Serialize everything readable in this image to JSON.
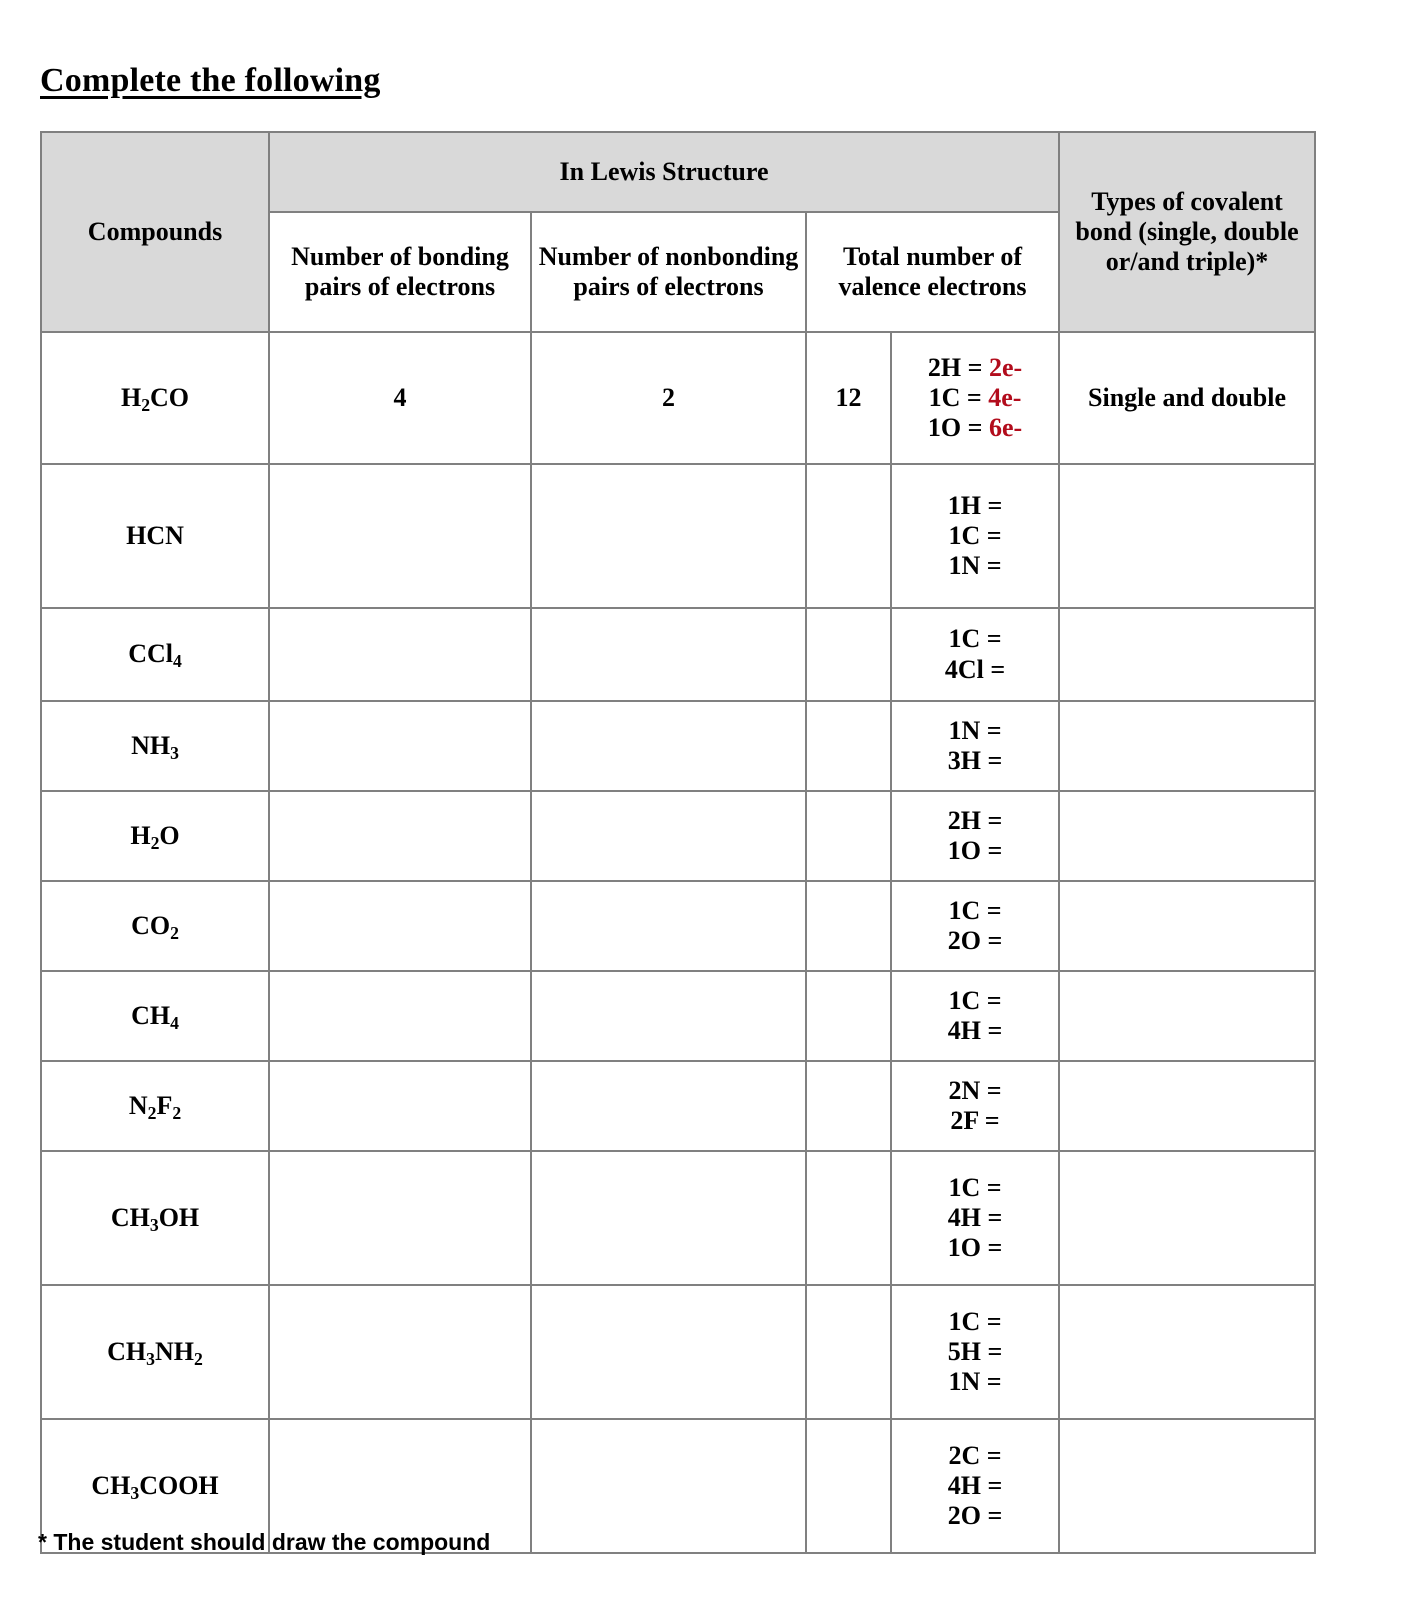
{
  "document": {
    "title": "Complete the following",
    "footnote": "* The student should draw the compound"
  },
  "colors": {
    "answer_red": "#b20c1c",
    "header_gray": "#d9d9d9",
    "border_gray": "#808080"
  },
  "table": {
    "headers": {
      "compounds": "Compounds",
      "lewis_group": "In Lewis Structure",
      "bonding_pairs": "Number of bonding pairs of electrons",
      "nonbonding_pairs": "Number of nonbonding pairs of electrons",
      "total_valence": "Total number of valence electrons",
      "bond_types": "Types of covalent bond (single, double or/and triple)*"
    },
    "rows": [
      {
        "compound": "H",
        "compound_sub1": "2",
        "compound_rest": "CO",
        "bonding_pairs": "4",
        "nonbonding_pairs": "2",
        "total_valence": "12",
        "breakdown": [
          {
            "label": "2H = ",
            "value": "2e-"
          },
          {
            "label": "1C = ",
            "value": "4e-"
          },
          {
            "label": "1O = ",
            "value": "6e-"
          }
        ],
        "bond_types": "Single and double"
      },
      {
        "compound": "HCN",
        "compound_sub1": "",
        "compound_rest": "",
        "bonding_pairs": "",
        "nonbonding_pairs": "",
        "total_valence": "",
        "breakdown": [
          {
            "label": "1H =",
            "value": ""
          },
          {
            "label": "1C =",
            "value": ""
          },
          {
            "label": "1N =",
            "value": ""
          }
        ],
        "bond_types": ""
      },
      {
        "compound": "CCl",
        "compound_sub1": "4",
        "compound_rest": "",
        "bonding_pairs": "",
        "nonbonding_pairs": "",
        "total_valence": "",
        "breakdown": [
          {
            "label": "1C =",
            "value": ""
          },
          {
            "label": "4Cl =",
            "value": ""
          }
        ],
        "bond_types": ""
      },
      {
        "compound": "NH",
        "compound_sub1": "3",
        "compound_rest": "",
        "bonding_pairs": "",
        "nonbonding_pairs": "",
        "total_valence": "",
        "breakdown": [
          {
            "label": "1N =",
            "value": ""
          },
          {
            "label": "3H =",
            "value": ""
          }
        ],
        "bond_types": ""
      },
      {
        "compound": "H",
        "compound_sub1": "2",
        "compound_rest": "O",
        "bonding_pairs": "",
        "nonbonding_pairs": "",
        "total_valence": "",
        "breakdown": [
          {
            "label": "2H =",
            "value": ""
          },
          {
            "label": "1O =",
            "value": ""
          }
        ],
        "bond_types": ""
      },
      {
        "compound": "CO",
        "compound_sub1": "2",
        "compound_rest": "",
        "bonding_pairs": "",
        "nonbonding_pairs": "",
        "total_valence": "",
        "breakdown": [
          {
            "label": "1C =",
            "value": ""
          },
          {
            "label": "2O =",
            "value": ""
          }
        ],
        "bond_types": ""
      },
      {
        "compound": "CH",
        "compound_sub1": "4",
        "compound_rest": "",
        "bonding_pairs": "",
        "nonbonding_pairs": "",
        "total_valence": "",
        "breakdown": [
          {
            "label": "1C =",
            "value": ""
          },
          {
            "label": "4H =",
            "value": ""
          }
        ],
        "bond_types": ""
      },
      {
        "compound": "N",
        "compound_sub1": "2",
        "compound_rest": "F",
        "compound_sub2": "2",
        "bonding_pairs": "",
        "nonbonding_pairs": "",
        "total_valence": "",
        "breakdown": [
          {
            "label": "2N =",
            "value": ""
          },
          {
            "label": "2F =",
            "value": ""
          }
        ],
        "bond_types": ""
      },
      {
        "compound": "CH",
        "compound_sub1": "3",
        "compound_rest": "OH",
        "bonding_pairs": "",
        "nonbonding_pairs": "",
        "total_valence": "",
        "breakdown": [
          {
            "label": "1C =",
            "value": ""
          },
          {
            "label": "4H =",
            "value": ""
          },
          {
            "label": "1O =",
            "value": ""
          }
        ],
        "bond_types": ""
      },
      {
        "compound": "CH",
        "compound_sub1": "3",
        "compound_rest": "NH",
        "compound_sub2": "2",
        "bonding_pairs": "",
        "nonbonding_pairs": "",
        "total_valence": "",
        "breakdown": [
          {
            "label": "1C =",
            "value": ""
          },
          {
            "label": "5H =",
            "value": ""
          },
          {
            "label": "1N =",
            "value": ""
          }
        ],
        "bond_types": ""
      },
      {
        "compound": "CH",
        "compound_sub1": "3",
        "compound_rest": "COOH",
        "bonding_pairs": "",
        "nonbonding_pairs": "",
        "total_valence": "",
        "breakdown": [
          {
            "label": "2C =",
            "value": ""
          },
          {
            "label": "4H =",
            "value": ""
          },
          {
            "label": "2O =",
            "value": ""
          }
        ],
        "bond_types": ""
      }
    ]
  }
}
